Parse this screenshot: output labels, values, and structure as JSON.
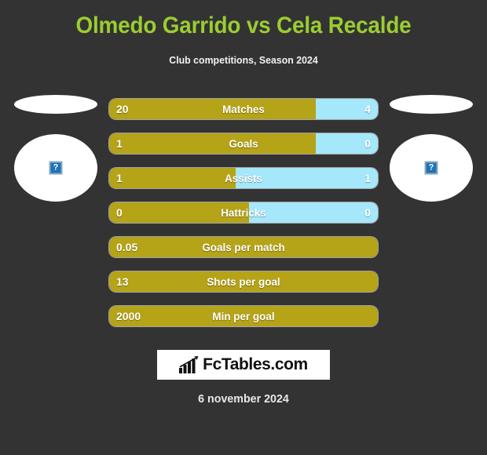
{
  "header": {
    "title": "Olmedo Garrido vs Cela Recalde",
    "subtitle": "Club competitions, Season 2024",
    "title_color": "#9ACD32"
  },
  "players": {
    "home": {
      "name": "",
      "photo_alt": "?"
    },
    "away": {
      "name": "",
      "photo_alt": "?"
    }
  },
  "colors": {
    "background": "#333333",
    "home_bar": "#B5A318",
    "away_bar": "#A5E7FB",
    "title": "#9ACD32"
  },
  "chart_data": {
    "type": "bar",
    "title": "Olmedo Garrido vs Cela Recalde",
    "subtitle": "Club competitions, Season 2024",
    "series": [
      {
        "name": "Olmedo Garrido",
        "color": "#B5A318"
      },
      {
        "name": "Cela Recalde",
        "color": "#A5E7FB"
      }
    ],
    "categories": [
      "Matches",
      "Goals",
      "Assists",
      "Hattricks",
      "Goals per match",
      "Shots per goal",
      "Min per goal"
    ],
    "rows": [
      {
        "label": "Matches",
        "home": "20",
        "away": "4",
        "home_pct": 77,
        "has_away": true
      },
      {
        "label": "Goals",
        "home": "1",
        "away": "0",
        "home_pct": 77,
        "has_away": true
      },
      {
        "label": "Assists",
        "home": "1",
        "away": "1",
        "home_pct": 47,
        "has_away": true
      },
      {
        "label": "Hattricks",
        "home": "0",
        "away": "0",
        "home_pct": 52,
        "has_away": true
      },
      {
        "label": "Goals per match",
        "home": "0.05",
        "away": "",
        "home_pct": 100,
        "has_away": false
      },
      {
        "label": "Shots per goal",
        "home": "13",
        "away": "",
        "home_pct": 100,
        "has_away": false
      },
      {
        "label": "Min per goal",
        "home": "2000",
        "away": "",
        "home_pct": 100,
        "has_away": false
      }
    ]
  },
  "footer": {
    "logo_text": "FcTables.com",
    "logo_icon": "bar-chart-icon",
    "date": "6 november 2024"
  }
}
